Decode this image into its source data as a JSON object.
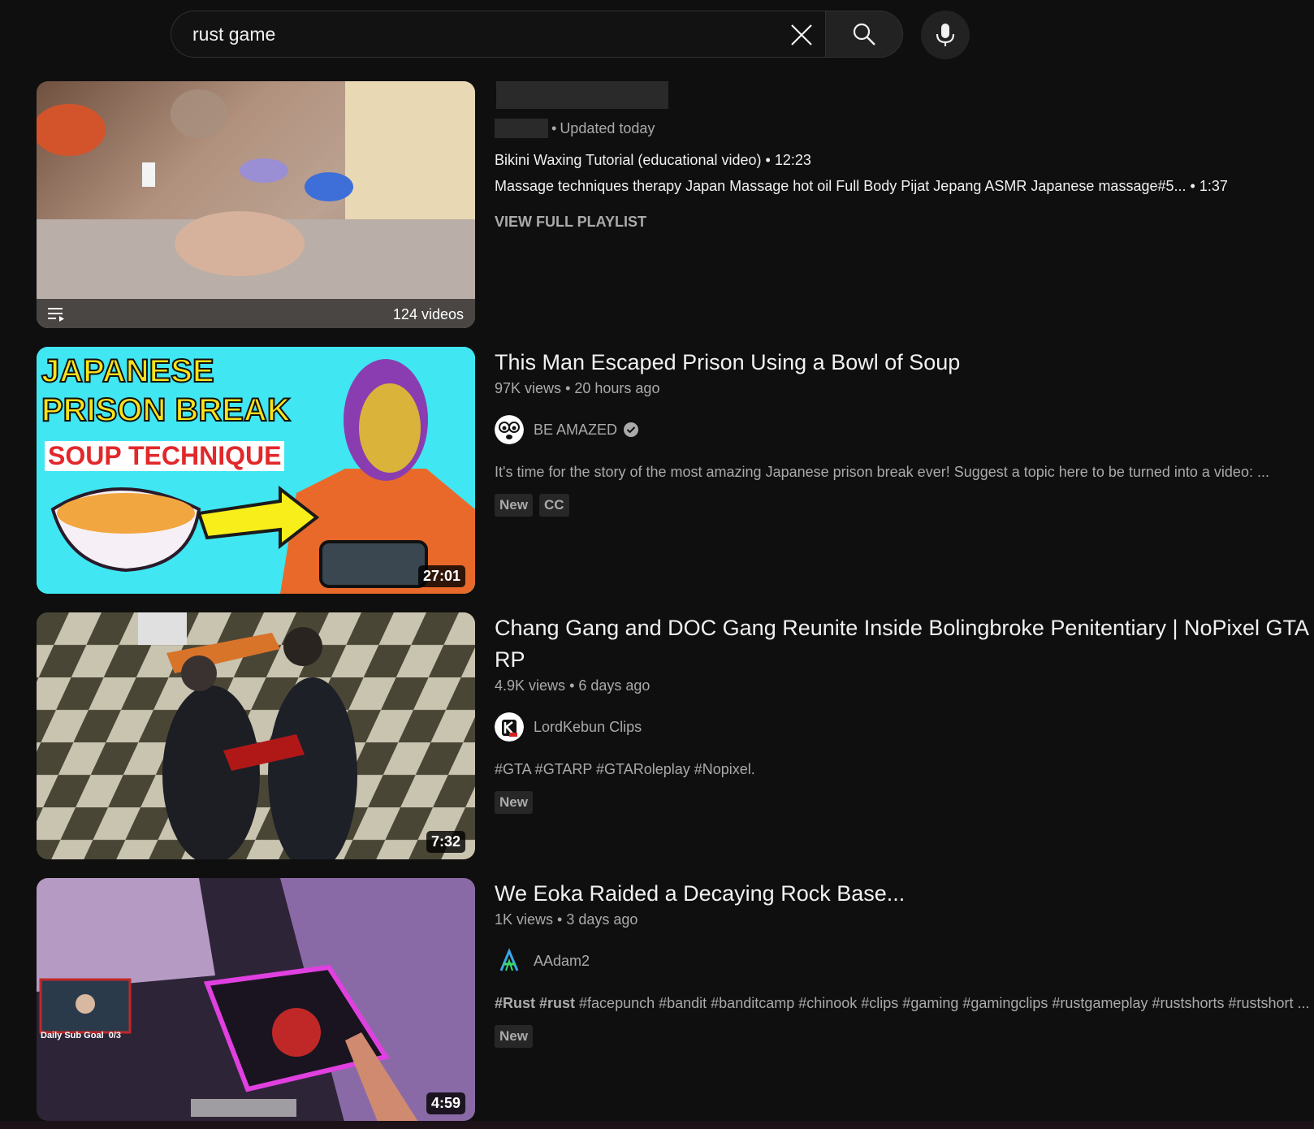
{
  "search": {
    "query": "rust game"
  },
  "playlist": {
    "updated": "Updated today",
    "video_count": "124 videos",
    "videos": [
      {
        "title": "Bikini Waxing Tutorial (educational video)",
        "duration": "12:23"
      },
      {
        "title": "Massage techniques therapy Japan Massage hot oil Full Body Pijat Jepang ASMR Japanese massage#5...",
        "duration": "1:37"
      }
    ],
    "view_full": "VIEW FULL PLAYLIST"
  },
  "results": [
    {
      "title": "This Man Escaped Prison Using a Bowl of Soup",
      "views": "97K views",
      "age": "20 hours ago",
      "channel": "BE AMAZED",
      "verified": true,
      "description": "It's time for the story of the most amazing Japanese prison break ever! Suggest a topic here to be turned into a video: ...",
      "badges": [
        "New",
        "CC"
      ],
      "duration": "27:01",
      "thumb_text": [
        "JAPANESE",
        "PRISON BREAK",
        "SOUP TECHNIQUE"
      ]
    },
    {
      "title": "Chang Gang and DOC Gang Reunite Inside Bolingbroke Penitentiary | NoPixel GTA RP",
      "views": "4.9K views",
      "age": "6 days ago",
      "channel": "LordKebun Clips",
      "description": "#GTA #GTARP #GTARoleplay #Nopixel.",
      "badges": [
        "New"
      ],
      "duration": "7:32"
    },
    {
      "title": "We Eoka Raided a Decaying Rock Base...",
      "views": "1K views",
      "age": "3 days ago",
      "channel": "AAdam2",
      "description_bold": "#Rust #rust",
      "description": " #facepunch #bandit #banditcamp #chinook #clips #gaming #gamingclips #rustgameplay #rustshorts #rustshort ...",
      "badges": [
        "New"
      ],
      "duration": "4:59",
      "thumb_text": [
        "Daily Sub Goal  0/3"
      ]
    }
  ],
  "colors": {
    "background": "#0f0f0f",
    "text": "#f1f1f1",
    "secondary": "#aaaaaa",
    "badge_bg": "#272727"
  }
}
